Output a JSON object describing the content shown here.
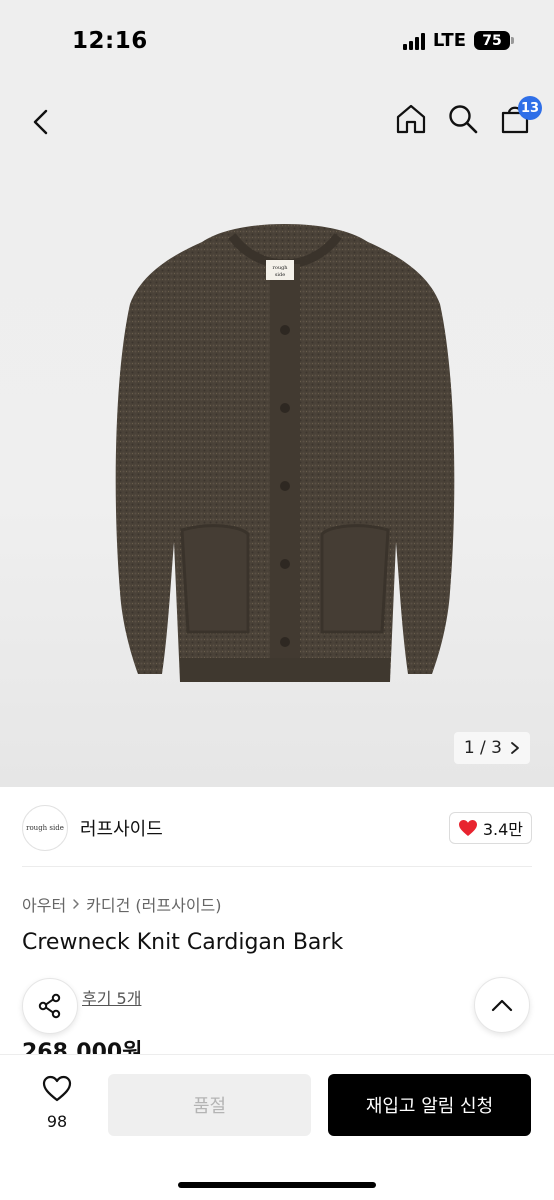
{
  "status_bar": {
    "time": "12:16",
    "network": "LTE",
    "battery": "75"
  },
  "header": {
    "cart_count": "13"
  },
  "gallery": {
    "page_indicator": "1 / 3",
    "tag_line1": "rough",
    "tag_line2": "side"
  },
  "brand": {
    "logo_text": "rough side",
    "name": "러프사이드",
    "likes": "3.4만"
  },
  "product": {
    "breadcrumb": [
      "아우터",
      "카디건 (러프사이드)"
    ],
    "title": "Crewneck Knit Cardigan Bark",
    "reviews": "후기 5개",
    "price": "268,000원"
  },
  "bottom_bar": {
    "wish_count": "98",
    "soldout_label": "품절",
    "restock_label": "재입고 알림 신청"
  },
  "colors": {
    "accent": "#2f6fe8",
    "like_heart": "#e8242f",
    "sweater": "#4a4238"
  },
  "icons": [
    "back-icon",
    "home-icon",
    "search-icon",
    "cart-icon",
    "chevron-right-icon",
    "heart-icon",
    "share-icon",
    "chevron-up-icon",
    "signal-icon",
    "battery-icon"
  ]
}
